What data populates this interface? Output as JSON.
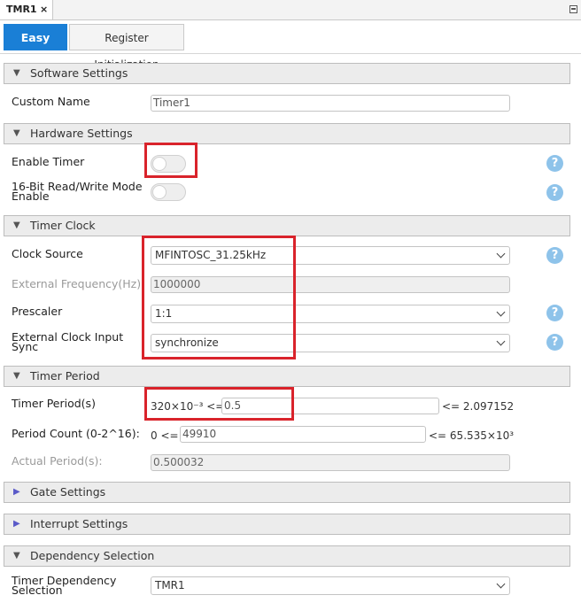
{
  "window": {
    "tab_title": "TMR1",
    "tab_close": "×"
  },
  "view_tabs": [
    {
      "label": "Easy View"
    },
    {
      "label": "Register Initialization"
    }
  ],
  "software": {
    "title": "Software Settings",
    "custom_name_label": "Custom Name",
    "custom_name_value": "Timer1"
  },
  "hardware": {
    "title": "Hardware Settings",
    "enable_timer_label": "Enable Timer",
    "enable_timer_on": false,
    "rw16_label_line1": "16-Bit Read/Write Mode",
    "rw16_label_line2": "Enable",
    "rw16_on": false
  },
  "clock": {
    "title": "Timer Clock",
    "source_label": "Clock Source",
    "source_value": "MFINTOSC_31.25kHz",
    "ext_freq_label": "External Frequency(Hz):",
    "ext_freq_value": "1000000",
    "prescaler_label": "Prescaler",
    "prescaler_value": "1:1",
    "ext_sync_label_line1": "External Clock Input",
    "ext_sync_label_line2": "Sync",
    "ext_sync_value": "synchronize"
  },
  "period": {
    "title": "Timer Period",
    "period_label": "Timer Period(s)",
    "period_min": "320×10⁻³ <=",
    "period_value": "0.5",
    "period_max": "<= 2.097152",
    "count_label": "Period Count (0-2^16):",
    "count_min": "0 <=",
    "count_value": "49910",
    "count_max": "<= 65.535×10³",
    "actual_label": "Actual Period(s):",
    "actual_value": "0.500032"
  },
  "gate": {
    "title": "Gate Settings"
  },
  "interrupt": {
    "title": "Interrupt Settings"
  },
  "dependency": {
    "title": "Dependency Selection",
    "dep_label_line1": "Timer Dependency",
    "dep_label_line2": "Selection",
    "dep_value": "TMR1"
  },
  "icons": {
    "help": "?",
    "collapse_caret": "▼",
    "expand_caret": "▶"
  },
  "colors": {
    "accent": "#1a7fd6",
    "highlight": "#d9232b",
    "help": "#8ec3ea"
  }
}
